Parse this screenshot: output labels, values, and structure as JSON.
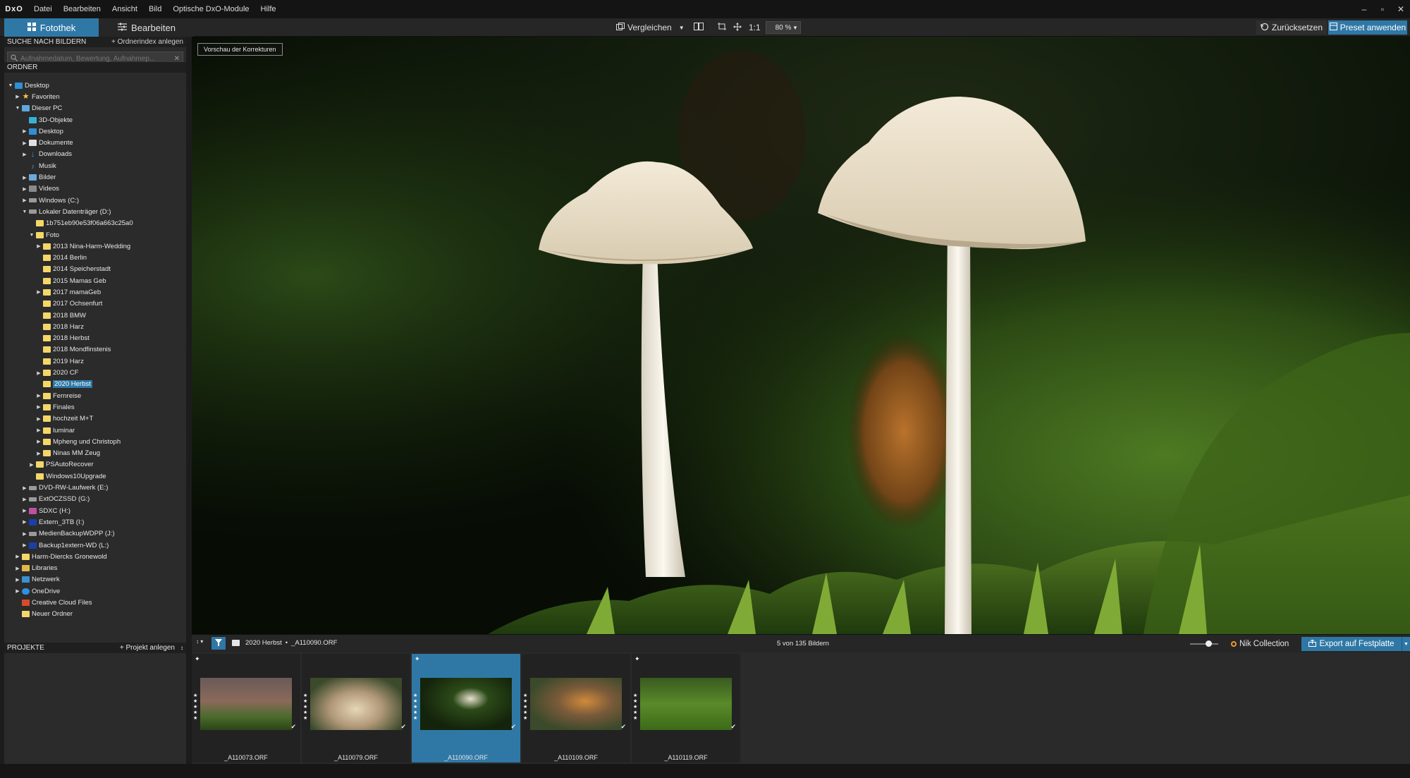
{
  "app": {
    "logo_text": "DxO",
    "menu": [
      "Datei",
      "Bearbeiten",
      "Ansicht",
      "Bild",
      "Optische DxO-Module",
      "Hilfe"
    ]
  },
  "window_controls": {
    "minimize": "–",
    "maximize": "▫",
    "close": "✕"
  },
  "tabs": {
    "library": "Fotothek",
    "edit": "Bearbeiten"
  },
  "toolbar": {
    "compare": "Vergleichen",
    "one_to_one": "1:1",
    "zoom_value": "80 %",
    "reset": "Zurücksetzen",
    "apply_preset": "Preset anwenden"
  },
  "search": {
    "header": "SUCHE NACH BILDERN",
    "add_index": "+ Ordnerindex anlegen",
    "placeholder": "Aufnahmedatum, Bewertung, Aufnahmep..."
  },
  "folders": {
    "header": "ORDNER",
    "tree": [
      {
        "label": "Desktop",
        "level": 0,
        "arrow": "▼",
        "icon": "desktop"
      },
      {
        "label": "Favoriten",
        "level": 1,
        "arrow": "▶",
        "icon": "star"
      },
      {
        "label": "Dieser PC",
        "level": 1,
        "arrow": "▼",
        "icon": "pc"
      },
      {
        "label": "3D-Objekte",
        "level": 2,
        "arrow": "",
        "icon": "3d"
      },
      {
        "label": "Desktop",
        "level": 2,
        "arrow": "▶",
        "icon": "desktop"
      },
      {
        "label": "Dokumente",
        "level": 2,
        "arrow": "▶",
        "icon": "doc"
      },
      {
        "label": "Downloads",
        "level": 2,
        "arrow": "▶",
        "icon": "down"
      },
      {
        "label": "Musik",
        "level": 2,
        "arrow": "",
        "icon": "music"
      },
      {
        "label": "Bilder",
        "level": 2,
        "arrow": "▶",
        "icon": "pic"
      },
      {
        "label": "Videos",
        "level": 2,
        "arrow": "▶",
        "icon": "video"
      },
      {
        "label": "Windows (C:)",
        "level": 2,
        "arrow": "▶",
        "icon": "drive"
      },
      {
        "label": "Lokaler Datenträger (D:)",
        "level": 2,
        "arrow": "▼",
        "icon": "drive"
      },
      {
        "label": "1b751eb90e53f06a663c25a0",
        "level": 3,
        "arrow": "",
        "icon": "folder"
      },
      {
        "label": "Foto",
        "level": 3,
        "arrow": "▼",
        "icon": "folder"
      },
      {
        "label": "2013 Nina-Harm-Wedding",
        "level": 4,
        "arrow": "▶",
        "icon": "folder"
      },
      {
        "label": "2014 Berlin",
        "level": 4,
        "arrow": "",
        "icon": "folder"
      },
      {
        "label": "2014 Speicherstadt",
        "level": 4,
        "arrow": "",
        "icon": "folder"
      },
      {
        "label": "2015 Mamas Geb",
        "level": 4,
        "arrow": "",
        "icon": "folder"
      },
      {
        "label": "2017 mamaGeb",
        "level": 4,
        "arrow": "▶",
        "icon": "folder"
      },
      {
        "label": "2017 Ochsenfurt",
        "level": 4,
        "arrow": "",
        "icon": "folder"
      },
      {
        "label": "2018 BMW",
        "level": 4,
        "arrow": "",
        "icon": "folder"
      },
      {
        "label": "2018 Harz",
        "level": 4,
        "arrow": "",
        "icon": "folder"
      },
      {
        "label": "2018 Herbst",
        "level": 4,
        "arrow": "",
        "icon": "folder"
      },
      {
        "label": "2018 Mondfinstenis",
        "level": 4,
        "arrow": "",
        "icon": "folder"
      },
      {
        "label": "2019 Harz",
        "level": 4,
        "arrow": "",
        "icon": "folder"
      },
      {
        "label": "2020 CF",
        "level": 4,
        "arrow": "▶",
        "icon": "folder"
      },
      {
        "label": "2020 Herbst",
        "level": 4,
        "arrow": "",
        "icon": "folder",
        "selected": true
      },
      {
        "label": "Fernreise",
        "level": 4,
        "arrow": "▶",
        "icon": "folder"
      },
      {
        "label": "Finales",
        "level": 4,
        "arrow": "▶",
        "icon": "folder"
      },
      {
        "label": "hochzeit M+T",
        "level": 4,
        "arrow": "▶",
        "icon": "folder"
      },
      {
        "label": "luminar",
        "level": 4,
        "arrow": "▶",
        "icon": "folder"
      },
      {
        "label": "Mpheng und Christoph",
        "level": 4,
        "arrow": "▶",
        "icon": "folder"
      },
      {
        "label": "Ninas MM Zeug",
        "level": 4,
        "arrow": "▶",
        "icon": "folder"
      },
      {
        "label": "PSAutoRecover",
        "level": 3,
        "arrow": "▶",
        "icon": "folder"
      },
      {
        "label": "Windows10Upgrade",
        "level": 3,
        "arrow": "",
        "icon": "folder"
      },
      {
        "label": "DVD-RW-Laufwerk (E:)",
        "level": 2,
        "arrow": "▶",
        "icon": "drive"
      },
      {
        "label": "ExtOCZSSD (G:)",
        "level": 2,
        "arrow": "▶",
        "icon": "drive"
      },
      {
        "label": "SDXC (H:)",
        "level": 2,
        "arrow": "▶",
        "icon": "sd"
      },
      {
        "label": "Extern_3TB (I:)",
        "level": 2,
        "arrow": "▶",
        "icon": "hd"
      },
      {
        "label": "MedienBackupWDPP (J:)",
        "level": 2,
        "arrow": "▶",
        "icon": "drive"
      },
      {
        "label": "Backup1extern-WD (L:)",
        "level": 2,
        "arrow": "▶",
        "icon": "hd"
      },
      {
        "label": "Harm-Diercks Gronewold",
        "level": 1,
        "arrow": "▶",
        "icon": "folder"
      },
      {
        "label": "Libraries",
        "level": 1,
        "arrow": "▶",
        "icon": "lib"
      },
      {
        "label": "Netzwerk",
        "level": 1,
        "arrow": "▶",
        "icon": "net"
      },
      {
        "label": "OneDrive",
        "level": 1,
        "arrow": "▶",
        "icon": "cloud"
      },
      {
        "label": "Creative Cloud Files",
        "level": 1,
        "arrow": "",
        "icon": "cc"
      },
      {
        "label": "Neuer Ordner",
        "level": 1,
        "arrow": "",
        "icon": "folder"
      }
    ]
  },
  "projects": {
    "header": "PROJEKTE",
    "add": "+ Projekt anlegen"
  },
  "viewer": {
    "preview_label": "Vorschau der Korrekturen"
  },
  "filmbar": {
    "folder": "2020 Herbst",
    "separator": "•",
    "file": "_A110090.ORF",
    "count": "5 von 135 Bildern",
    "nik": "Nik Collection",
    "export": "Export auf Festplatte"
  },
  "thumbnails": [
    {
      "name": "_A110073.ORF",
      "selected": false
    },
    {
      "name": "_A110079.ORF",
      "selected": false
    },
    {
      "name": "_A110090.ORF",
      "selected": true
    },
    {
      "name": "_A110109.ORF",
      "selected": false
    },
    {
      "name": "_A110119.ORF",
      "selected": false
    }
  ],
  "colors": {
    "accent": "#2f78a6",
    "folder": "#f4d768",
    "panel": "#2b2b2b"
  }
}
